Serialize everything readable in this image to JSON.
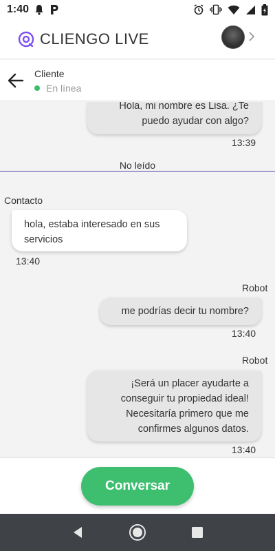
{
  "status_bar": {
    "time": "1:40",
    "left_icons": [
      "notification-bell-icon",
      "parking-p-icon"
    ],
    "right_icons": [
      "alarm-icon",
      "vibrate-icon",
      "wifi-icon",
      "signal-icon",
      "battery-icon"
    ]
  },
  "app": {
    "title": "CLIENGO LIVE",
    "logo_icon": "cliengo-logo-icon",
    "brand_color": "#7b4ff0"
  },
  "contact": {
    "name": "Cliente",
    "status": "En línea",
    "status_color": "#3dbc6b"
  },
  "messages": [
    {
      "direction": "out",
      "sender": "",
      "lines": [
        "Hola, mi nombre es Lisa. ¿Te",
        "puedo ayudar con algo?"
      ],
      "time": "13:39"
    },
    {
      "direction": "in",
      "sender": "Contacto",
      "lines": [
        "hola, estaba interesado en sus",
        "servicios"
      ],
      "time": "13:40"
    },
    {
      "direction": "out",
      "sender": "Robot",
      "lines": [
        "me podrías decir tu nombre?"
      ],
      "time": "13:40"
    },
    {
      "direction": "out",
      "sender": "Robot",
      "lines": [
        "¡Será un placer ayudarte a",
        "conseguir tu propiedad ideal!",
        "Necesitaría primero que me",
        "confirmes algunos datos."
      ],
      "time": "13:40"
    }
  ],
  "unread_label": "No leído",
  "footer": {
    "converse_label": "Conversar",
    "button_color": "#3dbf6f"
  },
  "nav_bar": {
    "icons": [
      "back-triangle-icon",
      "home-circle-icon",
      "recents-square-icon"
    ]
  }
}
